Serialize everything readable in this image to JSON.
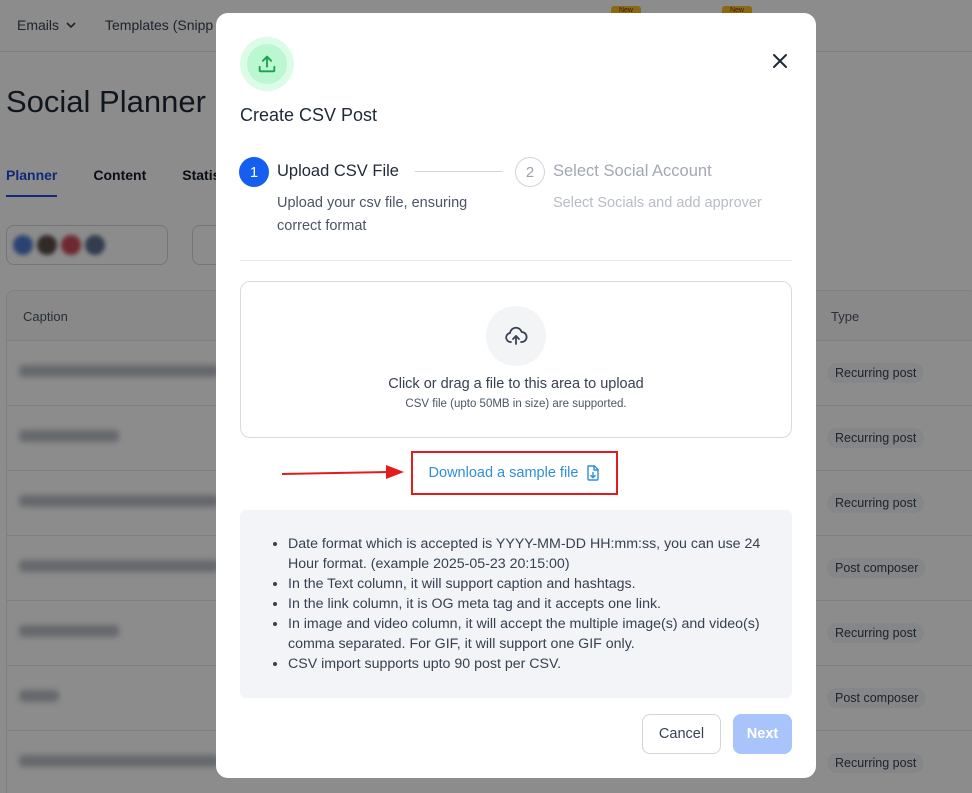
{
  "topnav": {
    "emails_label": "Emails",
    "templates_label": "Templates (Snipp",
    "new_badge": "New"
  },
  "page": {
    "title": "Social Planner",
    "tabs": [
      "Planner",
      "Content",
      "Statis"
    ]
  },
  "table": {
    "headers": {
      "caption": "Caption",
      "type": "Type"
    },
    "types": [
      "Recurring post",
      "Recurring post",
      "Recurring post",
      "Post composer",
      "Recurring post",
      "Post composer",
      "Recurring post"
    ]
  },
  "modal": {
    "title": "Create CSV Post",
    "steps": [
      {
        "number": "1",
        "title": "Upload CSV File",
        "description": "Upload your csv file, ensuring correct format"
      },
      {
        "number": "2",
        "title": "Select Social Account",
        "description": "Select Socials and add approver"
      }
    ],
    "dropzone": {
      "main_text": "Click or drag a file to this area to upload",
      "sub_text": "CSV file (upto 50MB in size) are supported."
    },
    "download_link": "Download a sample file",
    "info_items": [
      "Date format which is accepted is YYYY-MM-DD HH:mm:ss, you can use 24 Hour format. (example 2025-05-23 20:15:00)",
      "In the Text column, it will support caption and hashtags.",
      "In the link column, it is OG meta tag and it accepts one link.",
      "In image and video column, it will accept the multiple image(s) and video(s) comma separated. For GIF, it will support one GIF only.",
      "CSV import supports upto 90 post per CSV."
    ],
    "cancel_label": "Cancel",
    "next_label": "Next"
  },
  "colors": {
    "primary": "#155eef",
    "link": "#2e8fd9",
    "highlight": "#e11d1d",
    "upload_icon": "#16a34a"
  },
  "icons": {
    "header": "upload-icon",
    "close": "close-icon",
    "dropzone": "cloud-upload-icon",
    "download": "file-download-icon"
  }
}
